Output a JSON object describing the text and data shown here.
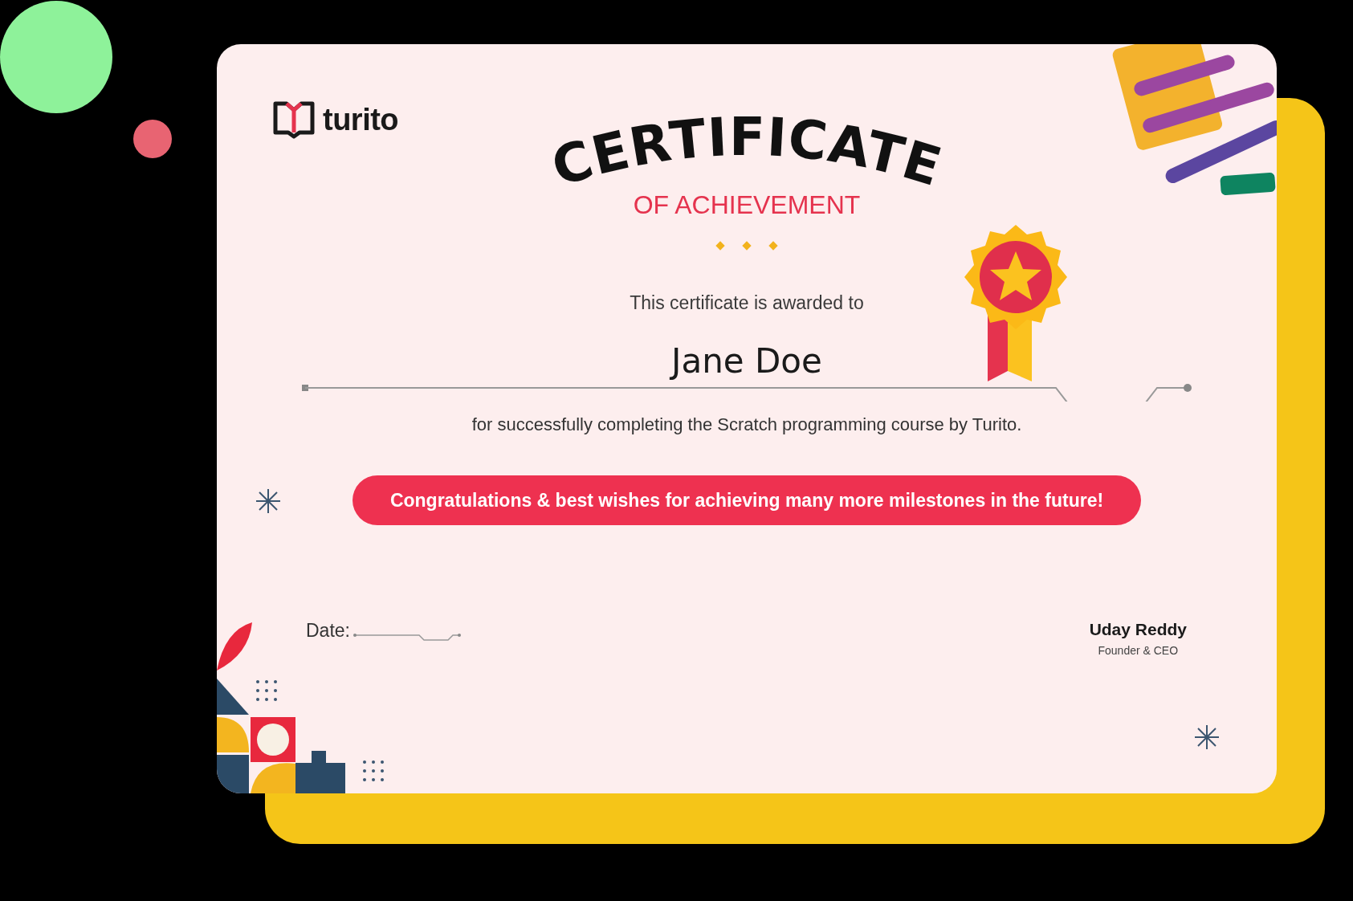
{
  "logo": {
    "wordmark": "turito"
  },
  "certificate": {
    "title": "CERTIFICATE",
    "subtitle": "OF ACHIEVEMENT",
    "intro": "This certificate is awarded to",
    "recipient": "Jane Doe",
    "description": "for successfully completing the Scratch programming course by Turito.",
    "banner": "Congratulations & best wishes for achieving many more milestones in the future!"
  },
  "footer": {
    "date_label": "Date:",
    "signer_name": "Uday Reddy",
    "signer_title": "Founder & CEO"
  }
}
